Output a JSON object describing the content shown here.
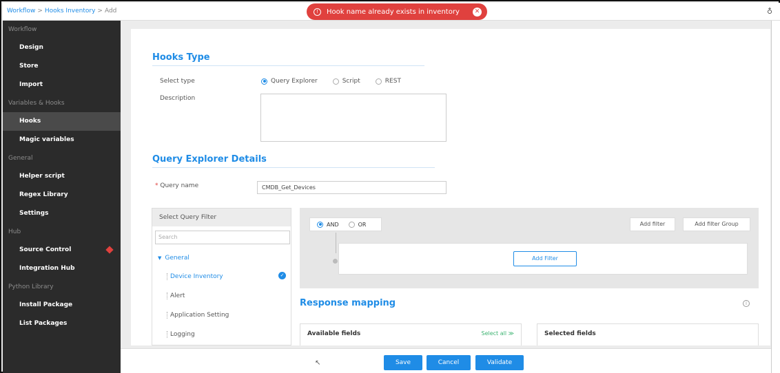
{
  "breadcrumb": {
    "items": [
      "Workflow",
      "Hooks Inventory",
      "Add"
    ],
    "separator": ">"
  },
  "toast": {
    "message": "Hook name already exists in inventory",
    "color": "#e0413e"
  },
  "sidebar": {
    "sections": [
      {
        "title": "Workflow",
        "items": [
          "Design",
          "Store",
          "Import"
        ]
      },
      {
        "title": "Variables & Hooks",
        "items": [
          "Hooks",
          "Magic variables"
        ]
      },
      {
        "title": "General",
        "items": [
          "Helper script",
          "Regex Library",
          "Settings"
        ]
      },
      {
        "title": "Hub",
        "items": [
          "Source Control",
          "Integration Hub"
        ]
      },
      {
        "title": "Python Library",
        "items": [
          "Install Package",
          "List Packages"
        ]
      }
    ],
    "active_item": "Hooks"
  },
  "hooks_type": {
    "title": "Hooks Type",
    "select_type_label": "Select type",
    "options": [
      "Query Explorer",
      "Script",
      "REST"
    ],
    "selected": "Query Explorer",
    "description_label": "Description",
    "description_value": ""
  },
  "query_explorer": {
    "title": "Query Explorer Details",
    "query_name_label": "Query name",
    "required_mark": "*",
    "query_name_value": "CMDB_Get_Devices"
  },
  "query_filter": {
    "header": "Select Query Filter",
    "search_placeholder": "Search",
    "group": "General",
    "items": [
      "Device Inventory",
      "Alert",
      "Application Setting",
      "Logging"
    ],
    "selected_item": "Device Inventory"
  },
  "filter_builder": {
    "logic_options": [
      "AND",
      "OR"
    ],
    "selected_logic": "AND",
    "add_filter_label": "Add filter",
    "add_filter_group_label": "Add filter Group",
    "add_filter_inner_label": "Add Filter"
  },
  "response_mapping": {
    "title": "Response mapping",
    "available_fields": "Available fields",
    "select_all": "Select all ≫",
    "selected_fields": "Selected fields"
  },
  "actions": {
    "save": "Save",
    "cancel": "Cancel",
    "validate": "Validate"
  },
  "colors": {
    "accent": "#1f8ce6",
    "sidebar_bg": "#2b2b2b",
    "danger": "#e0413e",
    "success": "#3cb371"
  }
}
